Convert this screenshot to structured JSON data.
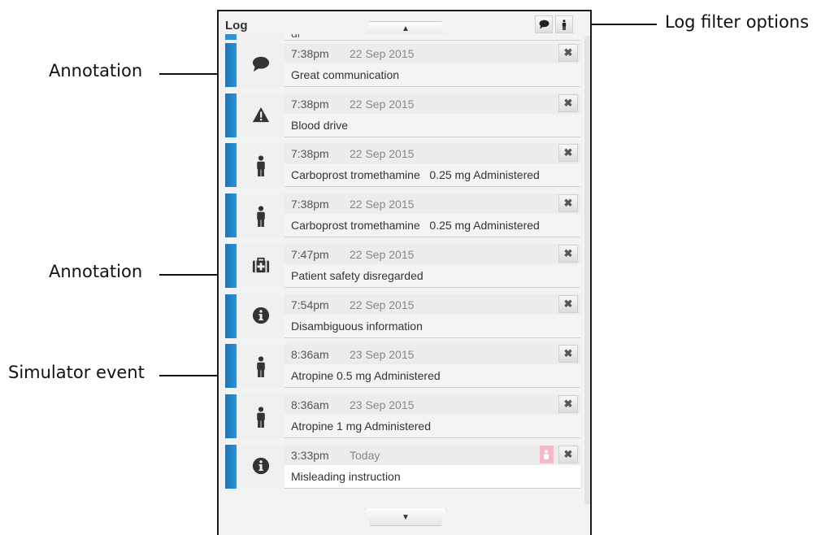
{
  "callouts": {
    "annotation_1": "Annotation",
    "annotation_2": "Annotation",
    "simulator_event": "Simulator event",
    "log_filter_options": "Log filter options"
  },
  "panel": {
    "title": "Log",
    "scroll_up_icon": "caret-up-icon",
    "scroll_down_icon": "caret-down-icon",
    "filters": [
      {
        "name": "annotation-filter",
        "icon": "speech-bubble-icon"
      },
      {
        "name": "simulator-event-filter",
        "icon": "person-icon"
      }
    ],
    "partial_entry_text": "dr",
    "close_glyph": "✖",
    "entries": [
      {
        "icon": "speech-bubble-icon",
        "time": "7:38pm",
        "date": "22 Sep 2015",
        "text": "Great communication"
      },
      {
        "icon": "warning-icon",
        "time": "7:38pm",
        "date": "22 Sep 2015",
        "text": "Blood drive"
      },
      {
        "icon": "person-icon",
        "time": "7:38pm",
        "date": "22 Sep 2015",
        "text": "Carboprost tromethamine   0.25 mg Administered"
      },
      {
        "icon": "person-icon",
        "time": "7:38pm",
        "date": "22 Sep 2015",
        "text": "Carboprost tromethamine   0.25 mg Administered"
      },
      {
        "icon": "medical-kit-icon",
        "time": "7:47pm",
        "date": "22 Sep 2015",
        "text": "Patient safety disregarded"
      },
      {
        "icon": "info-icon",
        "time": "7:54pm",
        "date": "22 Sep 2015",
        "text": "Disambiguous information"
      },
      {
        "icon": "person-icon",
        "time": "8:36am",
        "date": "23 Sep 2015",
        "text": "Atropine 0.5 mg Administered"
      },
      {
        "icon": "person-icon",
        "time": "8:36am",
        "date": "23 Sep 2015",
        "text": "Atropine 1 mg Administered"
      },
      {
        "icon": "info-icon",
        "time": "3:33pm",
        "date": "Today",
        "text": "Misleading instruction",
        "flagged": true
      }
    ]
  },
  "colors": {
    "accent_blue": "#2f92d6",
    "flag_pink": "#f6b9c6",
    "panel_border": "#1a1a1a"
  }
}
